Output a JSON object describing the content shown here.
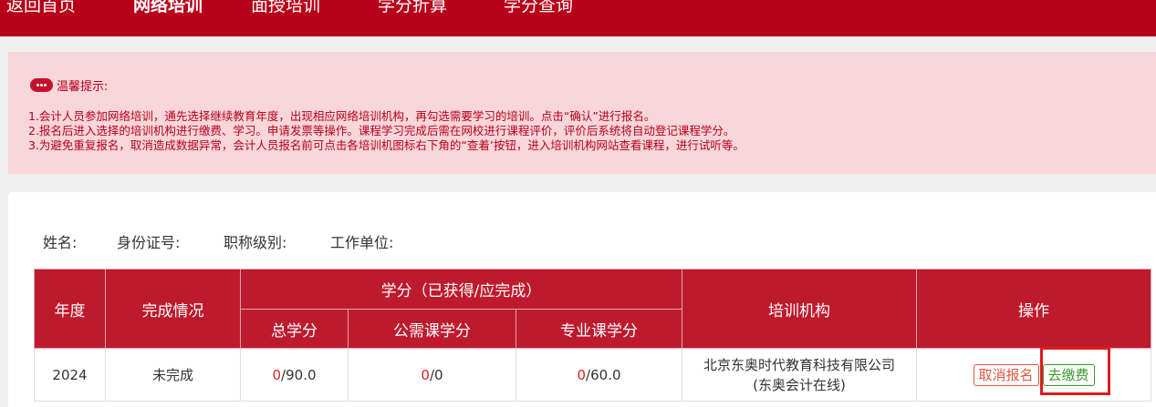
{
  "nav": {
    "items": [
      "返回首页",
      "网络培训",
      "面授培训",
      "学分折算",
      "学分查询"
    ],
    "active_index": 1
  },
  "notice": {
    "title": "温馨提示:",
    "lines": [
      "1.会计人员参加网络培训，通先选择继续教育年度，出现相应网络培训机构，再勾选需要学习的培训。点击“确认”进行报名。",
      "2.报名后进入选择的培训机构进行缴费、学习。申请发票等操作。课程学习完成后需在网校进行课程评价，评价后系统将自动登记课程学分。",
      "3.为避免重复报名，取消造成数据异常，会计人员报名前可点击各培训机图标右下角的“查着’按钮，进入培训机构网站查看课程，进行试听等。"
    ]
  },
  "person": {
    "name_label": "姓名:",
    "id_label": "身份证号:",
    "title_label": "职称级别:",
    "work_label": "工作单位:"
  },
  "table": {
    "headers": {
      "year": "年度",
      "status": "完成情况",
      "credits_group": "学分（已获得/应完成）",
      "total": "总学分",
      "public": "公需课学分",
      "professional": "专业课学分",
      "institution": "培训机构",
      "actions": "操作"
    },
    "rows": [
      {
        "year": "2024",
        "status": "未完成",
        "total_earned": "0",
        "total_required": "/90.0",
        "public_earned": "0",
        "public_required": "/0",
        "professional_earned": "0",
        "professional_required": "/60.0",
        "institution_line1": "北京东奥时代教育科技有限公司",
        "institution_line2": "(东奥会计在线)",
        "cancel_label": "取消报名",
        "pay_label": "去缴费"
      }
    ]
  },
  "colors": {
    "brand_red": "#b8001a",
    "header_red": "#be1a2d",
    "notice_bg": "#f8d6da",
    "cancel_orange": "#e05a3f",
    "pay_green": "#3c9a2d"
  }
}
